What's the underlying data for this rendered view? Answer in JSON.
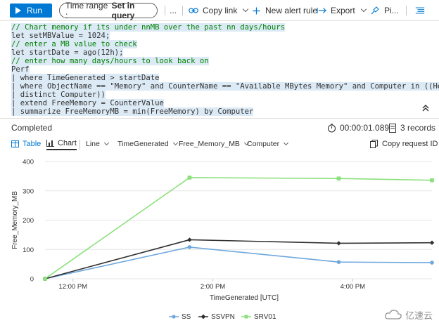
{
  "toolbar": {
    "run_label": "Run",
    "time_range_prefix": "Time range :",
    "time_range_value": "Set in query",
    "more_label": "...",
    "copy_link_label": "Copy link",
    "new_alert_label": "New alert rule",
    "export_label": "Export",
    "pin_label": "Pi..."
  },
  "query": {
    "lines": [
      "// Chart memory if its under nnMB over the past nn days/hours",
      "let setMBValue = 1024;",
      "// enter a MB value to check",
      "let startDate = ago(12h);",
      "// enter how many days/hours to look back on",
      "Perf",
      "| where TimeGenerated > startDate",
      "| where ObjectName == \"Memory\" and CounterName == \"Available MBytes Memory\" and Computer in ((Heartbeat",
      "| distinct Computer))",
      "| extend FreeMemory = CounterValue",
      "| summarize FreeMemoryMB = min(FreeMemory) by Computer"
    ]
  },
  "results": {
    "status": "Completed",
    "elapsed": "00:00:01.089",
    "records": "3 records",
    "tabs": {
      "table": "Table",
      "chart": "Chart"
    },
    "chart_type": "Line",
    "x_column": "TimeGenerated",
    "y_column": "Free_Memory_MB",
    "split_column": "Computer",
    "copy_request_id": "Copy request ID"
  },
  "chart_data": {
    "type": "line",
    "xlabel": "TimeGenerated [UTC]",
    "ylabel": "Free_Memory_MB",
    "ylim": [
      0,
      400
    ],
    "yticks": [
      0,
      100,
      200,
      300,
      400
    ],
    "xticks": [
      "12:00 PM",
      "2:00 PM",
      "4:00 PM"
    ],
    "grid": true,
    "legend_position": "bottom",
    "x": [
      "11:36 AM",
      "1:40 PM",
      "3:48 PM",
      "5:08 PM"
    ],
    "series": [
      {
        "name": "SS",
        "color": "#6ea7dc",
        "marker": "circle",
        "values": [
          0,
          108,
          57,
          55
        ]
      },
      {
        "name": "SSVPN",
        "color": "#323130",
        "marker": "diamond",
        "values": [
          0,
          133,
          121,
          123
        ]
      },
      {
        "name": "SRV01",
        "color": "#8ae07a",
        "marker": "square",
        "values": [
          0,
          345,
          342,
          336
        ]
      }
    ]
  },
  "watermark": "亿速云"
}
